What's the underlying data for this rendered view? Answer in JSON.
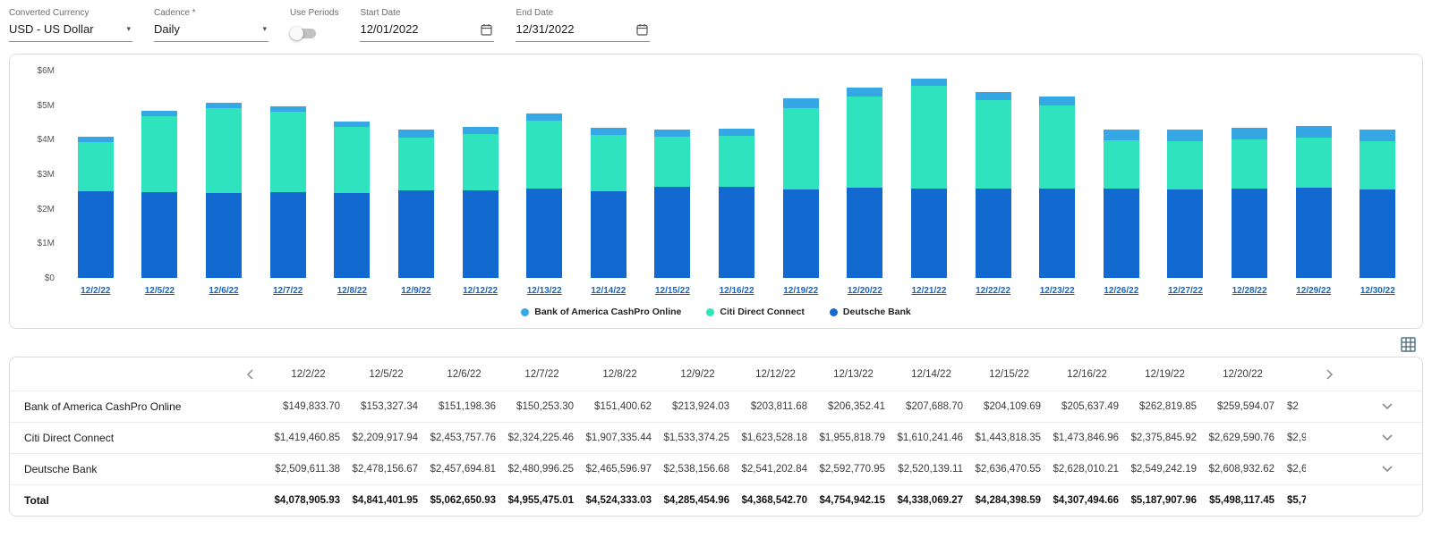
{
  "toolbar": {
    "currency": {
      "label": "Converted Currency",
      "value": "USD - US Dollar"
    },
    "cadence": {
      "label": "Cadence *",
      "value": "Daily"
    },
    "use_periods": {
      "label": "Use Periods",
      "enabled": false
    },
    "start_date": {
      "label": "Start Date",
      "value": "12/01/2022"
    },
    "end_date": {
      "label": "End Date",
      "value": "12/31/2022"
    }
  },
  "chart_data": {
    "type": "bar",
    "stacked": true,
    "title": "",
    "xlabel": "",
    "ylabel": "",
    "ylim": [
      0,
      6000000
    ],
    "y_ticks": [
      "$0",
      "$1M",
      "$2M",
      "$3M",
      "$4M",
      "$5M",
      "$6M"
    ],
    "grid": false,
    "legend_position": "bottom",
    "categories": [
      "12/2/22",
      "12/5/22",
      "12/6/22",
      "12/7/22",
      "12/8/22",
      "12/9/22",
      "12/12/22",
      "12/13/22",
      "12/14/22",
      "12/15/22",
      "12/16/22",
      "12/19/22",
      "12/20/22",
      "12/21/22",
      "12/22/22",
      "12/23/22",
      "12/26/22",
      "12/27/22",
      "12/28/22",
      "12/29/22",
      "12/30/22"
    ],
    "series": [
      {
        "name": "Bank of America CashPro Online",
        "color": "#35a7e5",
        "values": [
          149833.7,
          153327.34,
          151198.36,
          150253.3,
          151400.62,
          213924.03,
          203811.68,
          206352.41,
          207688.7,
          204109.69,
          205637.49,
          262819.85,
          259594.07,
          230000,
          240000,
          250000,
          320000,
          330000,
          350000,
          350000,
          350000
        ]
      },
      {
        "name": "Citi Direct Connect",
        "color": "#2ee3bd",
        "values": [
          1419460.85,
          2209917.94,
          2453757.76,
          2324225.46,
          1907335.44,
          1533374.25,
          1623528.18,
          1955818.79,
          1610241.46,
          1443818.35,
          1473846.96,
          2375845.92,
          2629590.76,
          2950000,
          2560000,
          2400000,
          1400000,
          1410000,
          1400000,
          1440000,
          1400000
        ]
      },
      {
        "name": "Deutsche Bank",
        "color": "#1269cf",
        "values": [
          2509611.38,
          2478156.67,
          2457694.81,
          2480996.25,
          2465596.97,
          2538156.68,
          2541202.84,
          2592770.95,
          2520139.11,
          2636470.55,
          2628010.21,
          2549242.19,
          2608932.62,
          2600000,
          2590000,
          2600000,
          2580000,
          2550000,
          2600000,
          2610000,
          2550000
        ]
      }
    ]
  },
  "table": {
    "columns": [
      "12/2/22",
      "12/5/22",
      "12/6/22",
      "12/7/22",
      "12/8/22",
      "12/9/22",
      "12/12/22",
      "12/13/22",
      "12/14/22",
      "12/15/22",
      "12/16/22",
      "12/19/22",
      "12/20/22"
    ],
    "rows": [
      {
        "label": "Bank of America CashPro Online",
        "bold": false,
        "expandable": true,
        "clipped": "$2",
        "values": [
          "$149,833.70",
          "$153,327.34",
          "$151,198.36",
          "$150,253.30",
          "$151,400.62",
          "$213,924.03",
          "$203,811.68",
          "$206,352.41",
          "$207,688.70",
          "$204,109.69",
          "$205,637.49",
          "$262,819.85",
          "$259,594.07"
        ]
      },
      {
        "label": "Citi Direct Connect",
        "bold": false,
        "expandable": true,
        "clipped": "$2,9",
        "values": [
          "$1,419,460.85",
          "$2,209,917.94",
          "$2,453,757.76",
          "$2,324,225.46",
          "$1,907,335.44",
          "$1,533,374.25",
          "$1,623,528.18",
          "$1,955,818.79",
          "$1,610,241.46",
          "$1,443,818.35",
          "$1,473,846.96",
          "$2,375,845.92",
          "$2,629,590.76"
        ]
      },
      {
        "label": "Deutsche Bank",
        "bold": false,
        "expandable": true,
        "clipped": "$2,6",
        "values": [
          "$2,509,611.38",
          "$2,478,156.67",
          "$2,457,694.81",
          "$2,480,996.25",
          "$2,465,596.97",
          "$2,538,156.68",
          "$2,541,202.84",
          "$2,592,770.95",
          "$2,520,139.11",
          "$2,636,470.55",
          "$2,628,010.21",
          "$2,549,242.19",
          "$2,608,932.62"
        ]
      },
      {
        "label": "Total",
        "bold": true,
        "expandable": false,
        "clipped": "$5,7",
        "values": [
          "$4,078,905.93",
          "$4,841,401.95",
          "$5,062,650.93",
          "$4,955,475.01",
          "$4,524,333.03",
          "$4,285,454.96",
          "$4,368,542.70",
          "$4,754,942.15",
          "$4,338,069.27",
          "$4,284,398.59",
          "$4,307,494.66",
          "$5,187,907.96",
          "$5,498,117.45"
        ]
      }
    ]
  }
}
